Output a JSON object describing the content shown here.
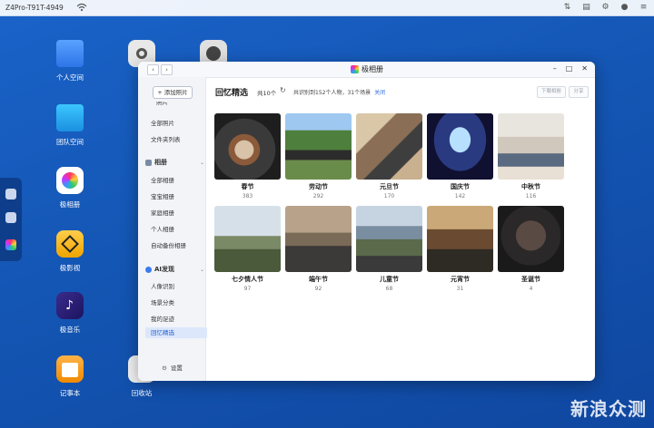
{
  "topbar": {
    "device_name": "Z4Pro-T91T-4949"
  },
  "desktop": {
    "icons": [
      {
        "label": "个人空间"
      },
      {
        "label": "团队空间"
      },
      {
        "label": "极相册"
      },
      {
        "label": "极影视"
      },
      {
        "label": "极音乐"
      },
      {
        "label": "记事本"
      },
      {
        "label": "回收站"
      }
    ]
  },
  "window": {
    "title": "极相册",
    "sidebar": {
      "add_button": "+ 添加照片",
      "section_partial": "照片",
      "items_photos": [
        "全部照片",
        "文件夹列表"
      ],
      "group_albums": "相册",
      "items_albums": [
        "全部相册",
        "宝宝相册",
        "家庭相册",
        "个人相册",
        "自动备份相册"
      ],
      "group_ai": "AI发现",
      "items_ai": [
        "人像识别",
        "场景分类",
        "我的足迹",
        "回忆精选"
      ],
      "settings": "设置"
    },
    "main": {
      "title": "回忆精选",
      "count": "共10个",
      "info": "共识别到152个人物，31个场景",
      "close_link": "关闭",
      "btn_download": "下载相册",
      "btn_share": "分享"
    },
    "cards": [
      {
        "name": "春节",
        "count": "383"
      },
      {
        "name": "劳动节",
        "count": "292"
      },
      {
        "name": "元旦节",
        "count": "170"
      },
      {
        "name": "国庆节",
        "count": "142"
      },
      {
        "name": "中秋节",
        "count": "116"
      },
      {
        "name": "七夕情人节",
        "count": "97"
      },
      {
        "name": "端午节",
        "count": "92"
      },
      {
        "name": "儿童节",
        "count": "68"
      },
      {
        "name": "元宵节",
        "count": "31"
      },
      {
        "name": "圣诞节",
        "count": "4"
      }
    ]
  },
  "watermark": "新浪众测"
}
